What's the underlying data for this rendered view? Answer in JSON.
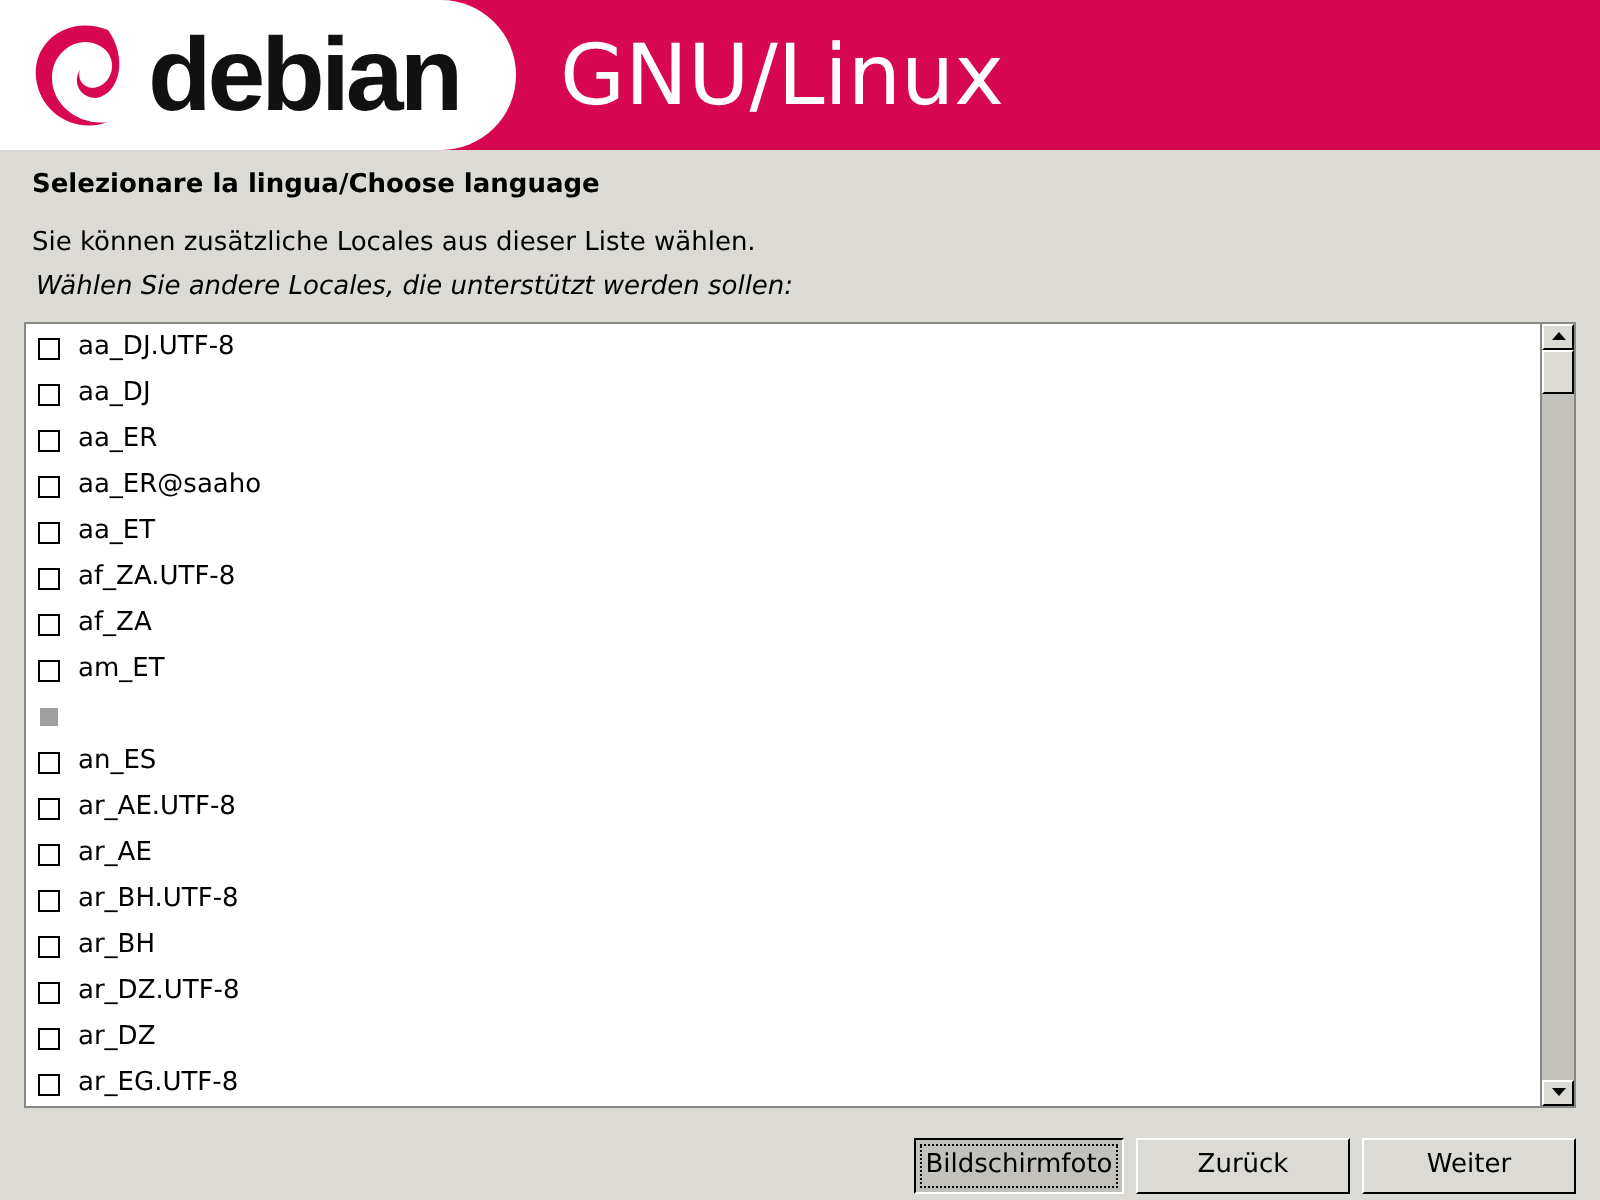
{
  "header": {
    "logo_text": "debian",
    "title": "GNU/Linux"
  },
  "heading": "Selezionare la lingua/Choose language",
  "description": "Sie können zusätzliche Locales aus dieser Liste wählen.",
  "prompt": "Wählen Sie andere Locales, die unterstützt werden sollen:",
  "locales": [
    {
      "kind": "checkbox",
      "label": "aa_DJ.UTF-8",
      "checked": false
    },
    {
      "kind": "checkbox",
      "label": "aa_DJ",
      "checked": false
    },
    {
      "kind": "checkbox",
      "label": "aa_ER",
      "checked": false
    },
    {
      "kind": "checkbox",
      "label": "aa_ER@saaho",
      "checked": false
    },
    {
      "kind": "checkbox",
      "label": "aa_ET",
      "checked": false
    },
    {
      "kind": "checkbox",
      "label": "af_ZA.UTF-8",
      "checked": false
    },
    {
      "kind": "checkbox",
      "label": "af_ZA",
      "checked": false
    },
    {
      "kind": "checkbox",
      "label": "am_ET",
      "checked": false
    },
    {
      "kind": "blank"
    },
    {
      "kind": "checkbox",
      "label": "an_ES",
      "checked": false
    },
    {
      "kind": "checkbox",
      "label": "ar_AE.UTF-8",
      "checked": false
    },
    {
      "kind": "checkbox",
      "label": "ar_AE",
      "checked": false
    },
    {
      "kind": "checkbox",
      "label": "ar_BH.UTF-8",
      "checked": false
    },
    {
      "kind": "checkbox",
      "label": "ar_BH",
      "checked": false
    },
    {
      "kind": "checkbox",
      "label": "ar_DZ.UTF-8",
      "checked": false
    },
    {
      "kind": "checkbox",
      "label": "ar_DZ",
      "checked": false
    },
    {
      "kind": "checkbox",
      "label": "ar_EG.UTF-8",
      "checked": false
    }
  ],
  "buttons": [
    {
      "label": "Bildschirmfoto",
      "focused": true
    },
    {
      "label": "Zurück",
      "focused": false
    },
    {
      "label": "Weiter",
      "focused": false
    }
  ]
}
